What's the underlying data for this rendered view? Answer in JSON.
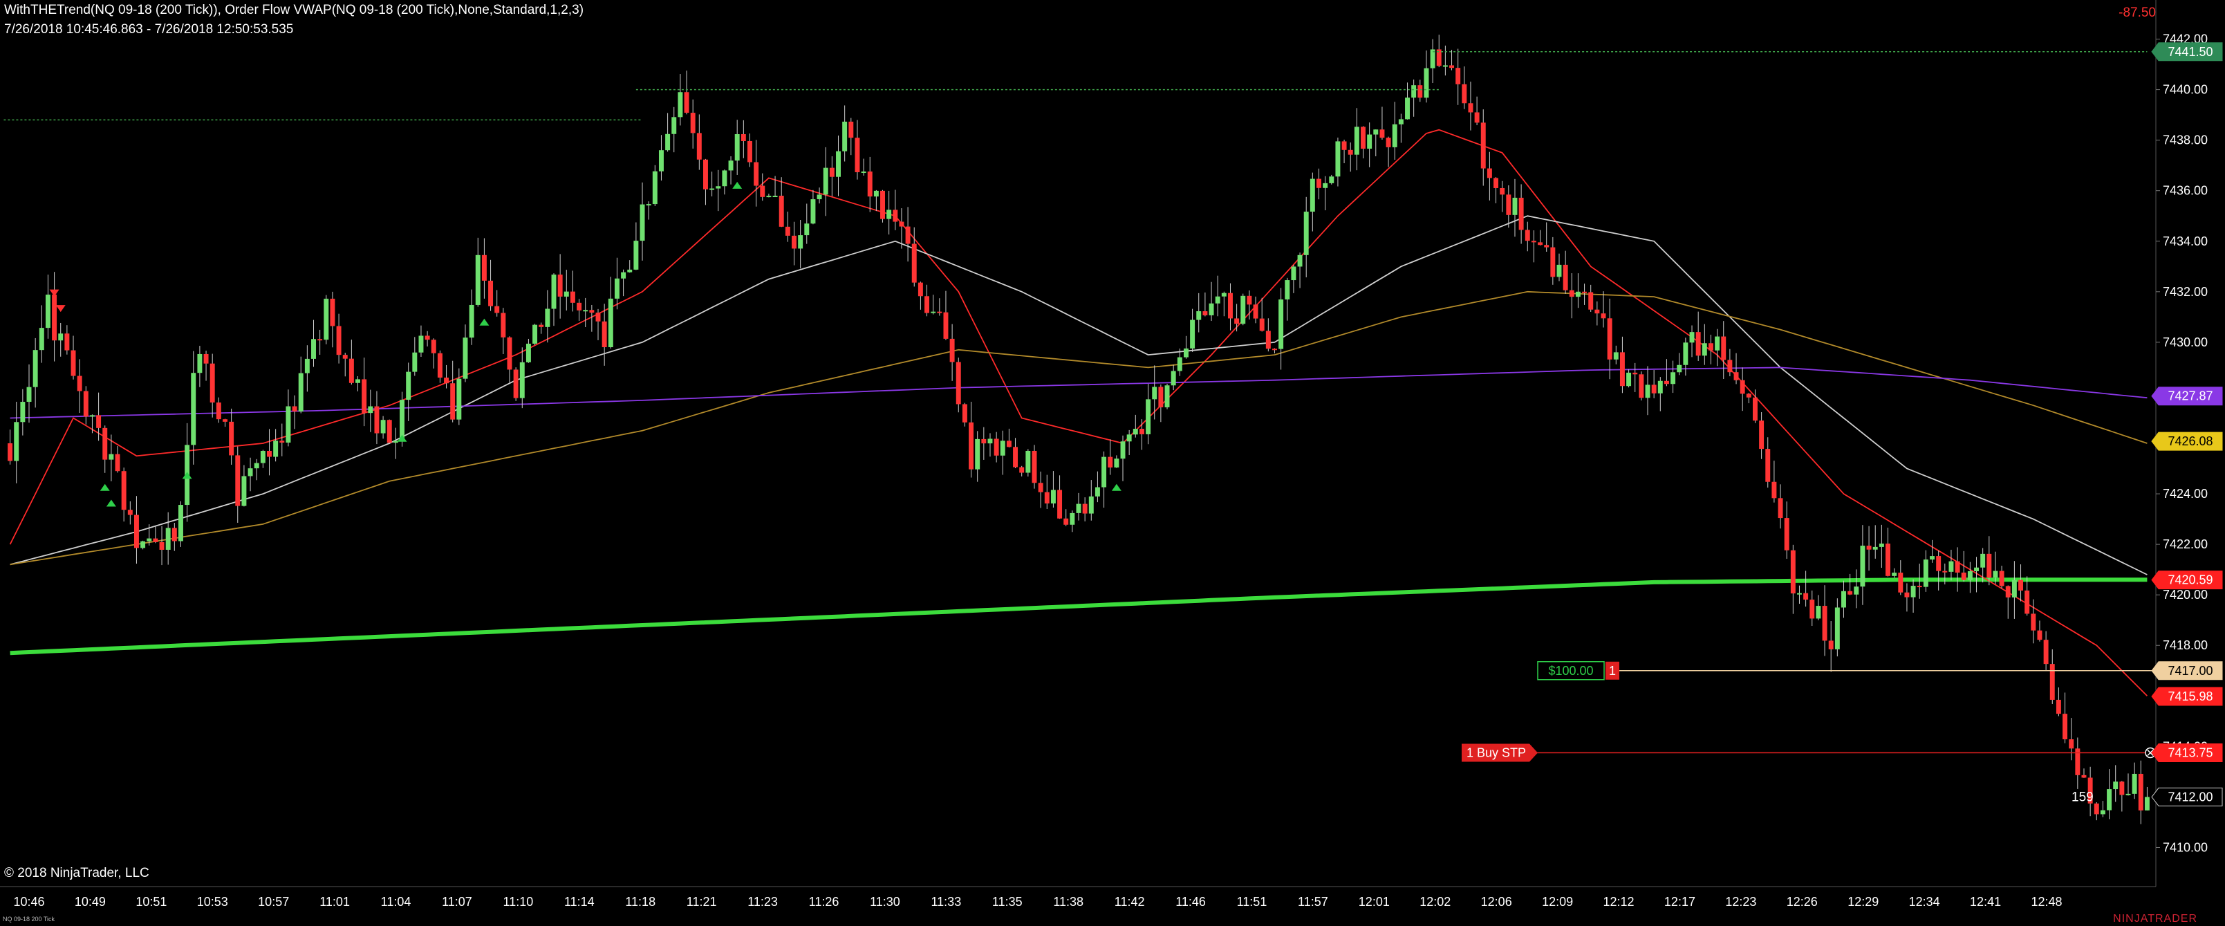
{
  "header": {
    "line1": "WithTHETrend(NQ 09-18 (200 Tick)), Order Flow VWAP(NQ 09-18 (200 Tick),None,Standard,1,2,3)",
    "line2": "7/26/2018 10:45:46.863 - 7/26/2018 12:50:53.535",
    "pnl": "-87.50"
  },
  "footer": {
    "copyright": "© 2018 NinjaTrader, LLC",
    "instrument": "NQ 09-18 200 Tick",
    "brand": "NINJATRADER"
  },
  "colors": {
    "background": "#000000",
    "up_candle": "#6fe06f",
    "down_candle": "#ff3434",
    "vwap": "#3cdc3c",
    "ema_fast": "#ff2a2a",
    "ma_white": "#cfcfcf",
    "ma_gold": "#b28a2a",
    "ma_purple": "#8a38e6",
    "buy_arrow": "#2fcf4a",
    "sell_arrow": "#ff3030"
  },
  "order_line": {
    "label": "1 Buy STP",
    "price": 7413.75,
    "price_label": "7413.75"
  },
  "position_line": {
    "pnl_label": "$100.00",
    "qty": "1",
    "price": 7417.0,
    "price_label": "7417.00"
  },
  "tick_counter": "159",
  "chart_data": {
    "type": "candlestick",
    "instrument": "NQ 09-18 (200 Tick)",
    "y_range": [
      7409,
      7443
    ],
    "y_ticks": [
      "7442.00",
      "7440.00",
      "7438.00",
      "7436.00",
      "7434.00",
      "7432.00",
      "7430.00",
      "7428.00",
      "7426.00",
      "7424.00",
      "7422.00",
      "7420.00",
      "7418.00",
      "7416.00",
      "7414.00",
      "7412.00",
      "7410.00"
    ],
    "x_ticks": [
      "10:46",
      "10:49",
      "10:51",
      "10:53",
      "10:57",
      "11:01",
      "11:04",
      "11:07",
      "11:10",
      "11:14",
      "11:18",
      "11:21",
      "11:23",
      "11:26",
      "11:30",
      "11:33",
      "11:35",
      "11:38",
      "11:42",
      "11:46",
      "11:51",
      "11:57",
      "12:01",
      "12:02",
      "12:06",
      "12:09",
      "12:12",
      "12:17",
      "12:23",
      "12:26",
      "12:29",
      "12:34",
      "12:41",
      "12:48"
    ],
    "price_markers": [
      {
        "label": "7441.50",
        "price": 7441.5,
        "color": "#2e8b57",
        "text_color": "#ffffff"
      },
      {
        "label": "7427.87",
        "price": 7427.87,
        "color": "#8a38e6",
        "text_color": "#ffffff"
      },
      {
        "label": "7426.08",
        "price": 7426.08,
        "color": "#e8c81a",
        "text_color": "#000000"
      },
      {
        "label": "7420.59",
        "price": 7420.59,
        "color": "#ff2020",
        "text_color": "#ffffff"
      },
      {
        "label": "7417.00",
        "price": 7417.0,
        "color": "#f0d0a0",
        "text_color": "#000000"
      },
      {
        "label": "7415.98",
        "price": 7415.98,
        "color": "#ff2020",
        "text_color": "#ffffff"
      },
      {
        "label": "7413.75",
        "price": 7413.75,
        "color": "#ff2020",
        "text_color": "#ffffff"
      },
      {
        "label": "7412.00",
        "price": 7412.0,
        "color": "#000000",
        "text_color": "#ffffff"
      }
    ],
    "anchors": [
      [
        0,
        7426.0
      ],
      [
        6,
        7431.2
      ],
      [
        12,
        7427.5
      ],
      [
        20,
        7422.5
      ],
      [
        26,
        7422.0
      ],
      [
        30,
        7430.2
      ],
      [
        36,
        7424.2
      ],
      [
        44,
        7426.8
      ],
      [
        50,
        7431.2
      ],
      [
        54,
        7428.5
      ],
      [
        60,
        7426.0
      ],
      [
        66,
        7430.7
      ],
      [
        70,
        7427.5
      ],
      [
        74,
        7433.0
      ],
      [
        80,
        7428.0
      ],
      [
        86,
        7432.0
      ],
      [
        94,
        7430.5
      ],
      [
        100,
        7435.0
      ],
      [
        106,
        7440.0
      ],
      [
        110,
        7435.5
      ],
      [
        116,
        7438.0
      ],
      [
        124,
        7433.5
      ],
      [
        132,
        7438.2
      ],
      [
        140,
        7434.5
      ],
      [
        148,
        7430.0
      ],
      [
        152,
        7425.5
      ],
      [
        160,
        7425.5
      ],
      [
        168,
        7423.0
      ],
      [
        176,
        7426.0
      ],
      [
        182,
        7428.0
      ],
      [
        188,
        7431.0
      ],
      [
        196,
        7431.5
      ],
      [
        200,
        7430.0
      ],
      [
        206,
        7436.0
      ],
      [
        212,
        7438.0
      ],
      [
        220,
        7438.5
      ],
      [
        226,
        7441.5
      ],
      [
        230,
        7439.0
      ],
      [
        236,
        7436.0
      ],
      [
        242,
        7433.5
      ],
      [
        250,
        7431.5
      ],
      [
        254,
        7429.0
      ],
      [
        260,
        7427.5
      ],
      [
        266,
        7430.0
      ],
      [
        270,
        7430.0
      ],
      [
        276,
        7427.5
      ],
      [
        282,
        7420.0
      ],
      [
        288,
        7418.5
      ],
      [
        294,
        7422.0
      ],
      [
        300,
        7420.0
      ],
      [
        306,
        7421.5
      ],
      [
        312,
        7421.0
      ],
      [
        318,
        7420.0
      ],
      [
        324,
        7415.5
      ],
      [
        330,
        7411.5
      ],
      [
        334,
        7412.5
      ],
      [
        338,
        7412.0
      ]
    ],
    "ma_series": [
      {
        "id": "vwap",
        "color": "#3cdc3c",
        "points": [
          [
            0,
            7417.7
          ],
          [
            100,
            7418.8
          ],
          [
            200,
            7419.9
          ],
          [
            260,
            7420.5
          ],
          [
            300,
            7420.6
          ],
          [
            338,
            7420.6
          ]
        ]
      },
      {
        "id": "ema_fast",
        "color": "#ff2a2a",
        "points": [
          [
            0,
            7422.0
          ],
          [
            10,
            7427.0
          ],
          [
            20,
            7425.5
          ],
          [
            40,
            7426.0
          ],
          [
            60,
            7427.5
          ],
          [
            80,
            7429.5
          ],
          [
            100,
            7432.0
          ],
          [
            120,
            7436.5
          ],
          [
            140,
            7435.0
          ],
          [
            150,
            7432.0
          ],
          [
            160,
            7427.0
          ],
          [
            176,
            7426.0
          ],
          [
            190,
            7429.5
          ],
          [
            210,
            7435.0
          ],
          [
            225,
            7438.5
          ],
          [
            236,
            7437.5
          ],
          [
            250,
            7433.0
          ],
          [
            270,
            7429.5
          ],
          [
            290,
            7424.0
          ],
          [
            310,
            7421.0
          ],
          [
            330,
            7418.0
          ],
          [
            338,
            7416.0
          ]
        ]
      },
      {
        "id": "ma_white",
        "color": "#cfcfcf",
        "points": [
          [
            0,
            7421.2
          ],
          [
            20,
            7422.5
          ],
          [
            40,
            7424.0
          ],
          [
            60,
            7426.0
          ],
          [
            80,
            7428.5
          ],
          [
            100,
            7430.0
          ],
          [
            120,
            7432.5
          ],
          [
            140,
            7434.0
          ],
          [
            160,
            7432.0
          ],
          [
            180,
            7429.5
          ],
          [
            200,
            7430.0
          ],
          [
            220,
            7433.0
          ],
          [
            240,
            7435.0
          ],
          [
            260,
            7434.0
          ],
          [
            280,
            7429.0
          ],
          [
            300,
            7425.0
          ],
          [
            320,
            7423.0
          ],
          [
            338,
            7420.8
          ]
        ]
      },
      {
        "id": "ma_gold",
        "color": "#b28a2a",
        "points": [
          [
            0,
            7421.2
          ],
          [
            20,
            7422.0
          ],
          [
            40,
            7422.8
          ],
          [
            60,
            7424.5
          ],
          [
            80,
            7425.5
          ],
          [
            100,
            7426.5
          ],
          [
            120,
            7428.0
          ],
          [
            150,
            7429.7
          ],
          [
            180,
            7429.0
          ],
          [
            200,
            7429.5
          ],
          [
            220,
            7431.0
          ],
          [
            240,
            7432.0
          ],
          [
            260,
            7431.8
          ],
          [
            280,
            7430.5
          ],
          [
            300,
            7429.0
          ],
          [
            320,
            7427.5
          ],
          [
            338,
            7426.0
          ]
        ]
      },
      {
        "id": "ma_purple",
        "color": "#8a38e6",
        "points": [
          [
            0,
            7427.0
          ],
          [
            50,
            7427.3
          ],
          [
            100,
            7427.7
          ],
          [
            150,
            7428.2
          ],
          [
            200,
            7428.5
          ],
          [
            250,
            7428.9
          ],
          [
            280,
            7429.0
          ],
          [
            310,
            7428.5
          ],
          [
            338,
            7427.8
          ]
        ]
      }
    ],
    "buy_signals": [
      15,
      16,
      28,
      62,
      75,
      115,
      175
    ],
    "sell_signals": [
      7,
      8
    ],
    "highlight_lines": [
      {
        "price": 7438.8,
        "from": 0,
        "to": 100
      },
      {
        "price": 7440.0,
        "from": 100,
        "to": 226
      },
      {
        "price": 7441.5,
        "from": 226,
        "to": 338
      }
    ]
  }
}
